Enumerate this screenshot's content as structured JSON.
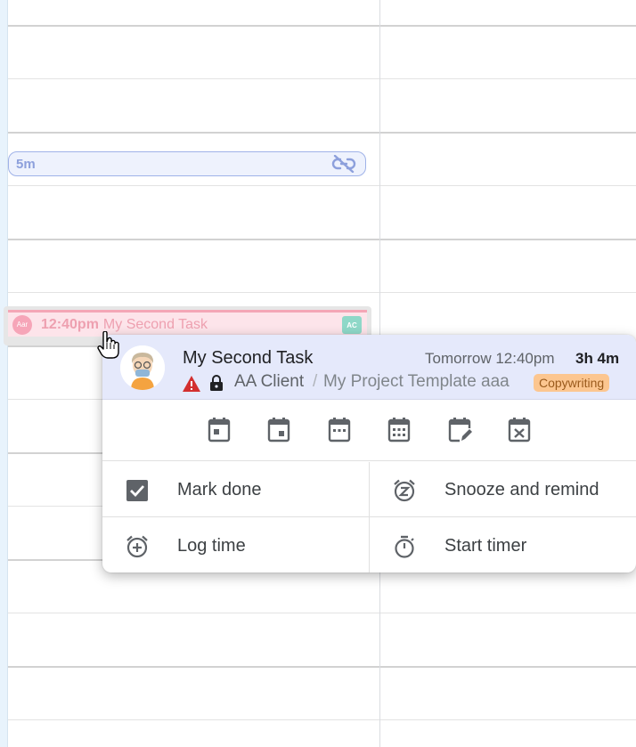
{
  "calendar": {
    "short_event": {
      "duration": "5m",
      "icon": "link-off-icon"
    },
    "task_event": {
      "avatar_initials": "Aar",
      "time": "12:40pm",
      "title": "My Second Task",
      "badge": "AC"
    }
  },
  "popup": {
    "title": "My Second Task",
    "when": "Tomorrow 12:40pm",
    "duration": "3h 4m",
    "client": "AA Client",
    "separator": "/",
    "project": "My Project Template aaa",
    "tag": "Copywriting",
    "schedule_icons": [
      "calendar-today-icon",
      "calendar-tomorrow-icon",
      "calendar-week-icon",
      "calendar-month-icon",
      "calendar-edit-icon",
      "calendar-remove-icon"
    ],
    "actions": {
      "mark_done": "Mark done",
      "snooze": "Snooze and remind",
      "log_time": "Log time",
      "start_timer": "Start timer"
    }
  },
  "colors": {
    "header_bg": "#e5e9fb",
    "tag_bg": "#fcc690",
    "task_pink": "#eea0b0",
    "chip_blue": "#8da0dc"
  }
}
